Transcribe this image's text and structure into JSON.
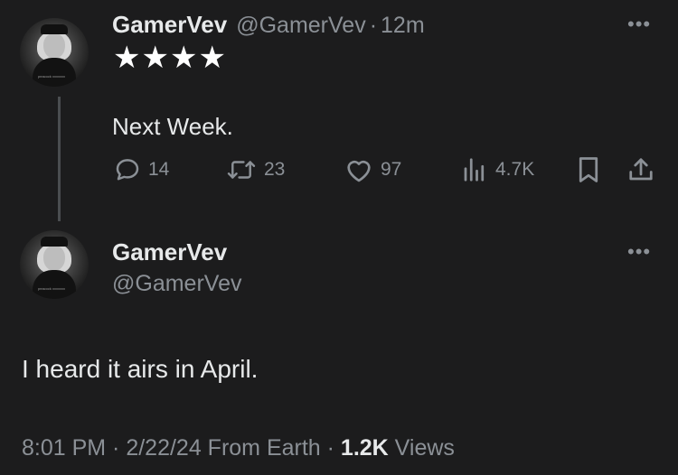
{
  "tweet": {
    "display_name": "GamerVev",
    "handle": "@GamerVev",
    "separator": "·",
    "time_ago": "12m",
    "stars": "★★★★",
    "text": "Next Week.",
    "replies": "14",
    "retweets": "23",
    "likes": "97",
    "views": "4.7K",
    "more_glyph": "•••"
  },
  "reply": {
    "display_name": "GamerVev",
    "handle": "@GamerVev",
    "text": "I heard it airs in April.",
    "timestamp": "8:01 PM · 2/22/24 From Earth · ",
    "views_count": "1.2K",
    "views_label": " Views",
    "more_glyph": "•••"
  },
  "avatar_caption": "peacock xxxxxxx",
  "colors": {
    "background": "#1c1c1d",
    "text": "#e7e9ea",
    "muted": "#8b9096",
    "thread_line": "#4a4d50"
  }
}
